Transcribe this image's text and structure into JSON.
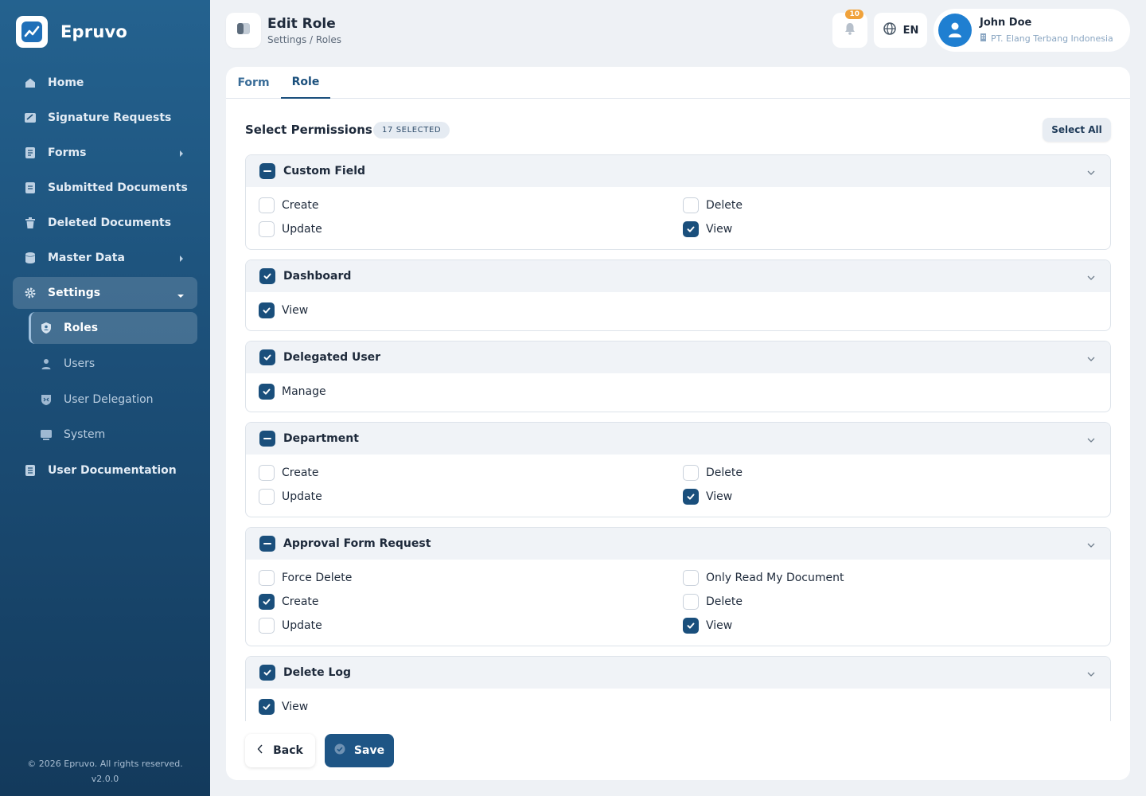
{
  "app": {
    "name": "Epruvo"
  },
  "sidebar": {
    "items": [
      {
        "label": "Home",
        "icon": "home-icon"
      },
      {
        "label": "Signature Requests",
        "icon": "signature-icon"
      },
      {
        "label": "Forms",
        "icon": "forms-icon"
      },
      {
        "label": "Submitted Documents",
        "icon": "document-icon"
      },
      {
        "label": "Deleted Documents",
        "icon": "trash-icon"
      },
      {
        "label": "Master Data",
        "icon": "database-icon"
      },
      {
        "label": "Settings",
        "icon": "gear-icon"
      },
      {
        "label": "User Documentation",
        "icon": "book-icon"
      }
    ],
    "settings_sub": [
      {
        "label": "Roles",
        "icon": "shield-icon"
      },
      {
        "label": "Users",
        "icon": "user-icon"
      },
      {
        "label": "User Delegation",
        "icon": "delegation-icon"
      },
      {
        "label": "System",
        "icon": "monitor-icon"
      }
    ],
    "footer": {
      "copyright": "© 2026 Epruvo. All rights reserved.",
      "version": "v2.0.0"
    }
  },
  "header": {
    "title": "Edit Role",
    "breadcrumb": "Settings / Roles",
    "notification_count": "10",
    "language": "EN",
    "user": {
      "name": "John Doe",
      "company": "PT. Elang Terbang Indonesia"
    }
  },
  "tabs": {
    "form": "Form",
    "role": "Role"
  },
  "permissions": {
    "title": "Select Permissions",
    "selected_badge": "17 SELECTED",
    "select_all": "Select All",
    "groups": [
      {
        "name": "Custom Field",
        "state": "mixed",
        "items": [
          {
            "label": "Create",
            "checked": false
          },
          {
            "label": "Delete",
            "checked": false
          },
          {
            "label": "Update",
            "checked": false
          },
          {
            "label": "View",
            "checked": true
          }
        ]
      },
      {
        "name": "Dashboard",
        "state": "checked",
        "items": [
          {
            "label": "View",
            "checked": true
          }
        ]
      },
      {
        "name": "Delegated User",
        "state": "checked",
        "items": [
          {
            "label": "Manage",
            "checked": true
          }
        ]
      },
      {
        "name": "Department",
        "state": "mixed",
        "items": [
          {
            "label": "Create",
            "checked": false
          },
          {
            "label": "Delete",
            "checked": false
          },
          {
            "label": "Update",
            "checked": false
          },
          {
            "label": "View",
            "checked": true
          }
        ]
      },
      {
        "name": "Approval Form Request",
        "state": "mixed",
        "items": [
          {
            "label": "Force Delete",
            "checked": false
          },
          {
            "label": "Only Read My Document",
            "checked": false
          },
          {
            "label": "Create",
            "checked": true
          },
          {
            "label": "Delete",
            "checked": false
          },
          {
            "label": "Update",
            "checked": false
          },
          {
            "label": "View",
            "checked": true
          }
        ]
      },
      {
        "name": "Delete Log",
        "state": "checked",
        "items": [
          {
            "label": "View",
            "checked": true
          }
        ]
      }
    ]
  },
  "actions": {
    "back": "Back",
    "save": "Save"
  },
  "colors": {
    "primary": "#1a4f7c",
    "sidebar": "#1c4f78",
    "badge": "#f0a23b"
  }
}
